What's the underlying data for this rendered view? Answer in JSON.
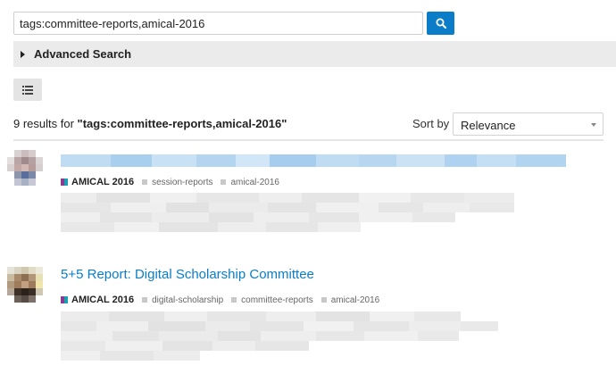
{
  "search": {
    "query": "tags:committee-reports,amical-2016",
    "button_icon": "search-icon"
  },
  "advanced": {
    "label": "Advanced Search"
  },
  "view_toggle": {
    "icon": "list-icon"
  },
  "results": {
    "count_text": "9 results for ",
    "query_text": "\"tags:committee-reports,amical-2016\""
  },
  "sort": {
    "label": "Sort by",
    "selected": "Relevance"
  },
  "items": [
    {
      "title": "",
      "category": "AMICAL 2016",
      "tags": [
        "session-reports",
        "amical-2016"
      ]
    },
    {
      "title": "5+5 Report: Digital Scholarship Committee",
      "category": "AMICAL 2016",
      "tags": [
        "digital-scholarship",
        "committee-reports",
        "amical-2016"
      ]
    }
  ],
  "colors": {
    "accent": "#0b7dc8",
    "category_icon_left": "#8b3a8f",
    "category_icon_right": "#1aa0b3"
  }
}
